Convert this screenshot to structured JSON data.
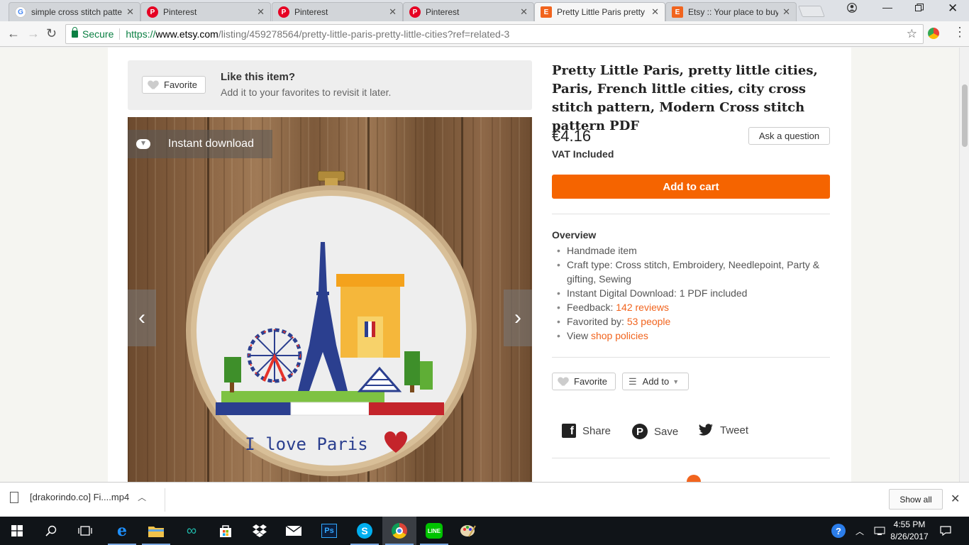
{
  "browser": {
    "tabs": [
      {
        "title": "simple cross stitch patte",
        "icon": "google-g-icon",
        "color": "#4285f4"
      },
      {
        "title": "Pinterest",
        "icon": "pinterest-icon",
        "color": "#e60023"
      },
      {
        "title": "Pinterest",
        "icon": "pinterest-icon",
        "color": "#e60023"
      },
      {
        "title": "Pinterest",
        "icon": "pinterest-icon",
        "color": "#e60023"
      },
      {
        "title": "Pretty Little Paris pretty",
        "icon": "etsy-icon",
        "color": "#f1641e"
      },
      {
        "title": "Etsy :: Your place to buy",
        "icon": "etsy-icon",
        "color": "#f1641e"
      }
    ],
    "active_tab_index": 4,
    "tab_close": "✕",
    "secure_label": "Secure",
    "url_scheme": "https://",
    "url_host": "www.etsy.com",
    "url_path": "/listing/459278564/pretty-little-paris-pretty-little-cities?ref=related-3"
  },
  "favorite_banner": {
    "button_label": "Favorite",
    "title": "Like this item?",
    "subtitle": "Add it to your favorites to revisit it later."
  },
  "image": {
    "badge": "Instant download",
    "prev_arrow": "‹",
    "next_arrow": "›",
    "embroidery_text": "I love Paris"
  },
  "product": {
    "title": "Pretty Little Paris, pretty little cities, Paris, French little cities, city cross stitch pattern, Modern Cross stitch pattern PDF",
    "price": "€4.16",
    "vat": "VAT Included",
    "ask_label": "Ask a question",
    "cart_label": "Add to cart",
    "cart_color": "#f56400"
  },
  "overview": {
    "heading": "Overview",
    "items": {
      "handmade": "Handmade item",
      "craft": "Craft type: Cross stitch, Embroidery, Needlepoint, Party & gifting, Sewing",
      "download": "Instant Digital Download: 1 PDF included",
      "feedback_prefix": "Feedback: ",
      "feedback_link": "142 reviews",
      "favorited_prefix": "Favorited by: ",
      "favorited_link": "53 people",
      "policies_prefix": "View ",
      "policies_link": "shop policies"
    }
  },
  "actions": {
    "favorite_label": "Favorite",
    "add_to_label": "Add to"
  },
  "share": {
    "share_label": "Share",
    "save_label": "Save",
    "tweet_label": "Tweet"
  },
  "downloads": {
    "filename": "[drakorindo.co] Fi....mp4",
    "show_all": "Show all"
  },
  "taskbar": {
    "time": "4:55 PM",
    "date": "8/26/2017"
  }
}
